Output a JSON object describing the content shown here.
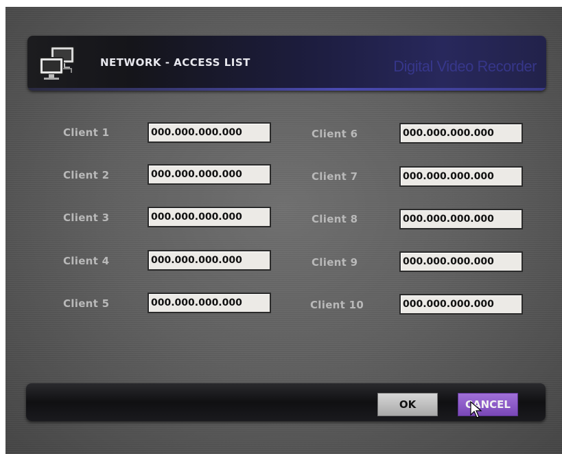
{
  "header": {
    "title": "NETWORK - ACCESS LIST",
    "brand": "Digital Video Recorder",
    "icon": "network-computers-icon"
  },
  "clients_left": [
    {
      "label": "Client  1",
      "ip": "000.000.000.000"
    },
    {
      "label": "Client  2",
      "ip": "000.000.000.000"
    },
    {
      "label": "Client  3",
      "ip": "000.000.000.000"
    },
    {
      "label": "Client  4",
      "ip": "000.000.000.000"
    },
    {
      "label": "Client  5",
      "ip": "000.000.000.000"
    }
  ],
  "clients_right": [
    {
      "label": "Client  6",
      "ip": "000.000.000.000"
    },
    {
      "label": "Client  7",
      "ip": "000.000.000.000"
    },
    {
      "label": "Client  8",
      "ip": "000.000.000.000"
    },
    {
      "label": "Client  9",
      "ip": "000.000.000.000"
    },
    {
      "label": "Client 10",
      "ip": "000.000.000.000"
    }
  ],
  "footer": {
    "ok_label": "OK",
    "cancel_label": "CANCEL"
  },
  "colors": {
    "accent": "#7a48b8",
    "header_blue": "#28285c",
    "field_bg": "#eceae6",
    "label_gray": "#b9b9b9"
  }
}
